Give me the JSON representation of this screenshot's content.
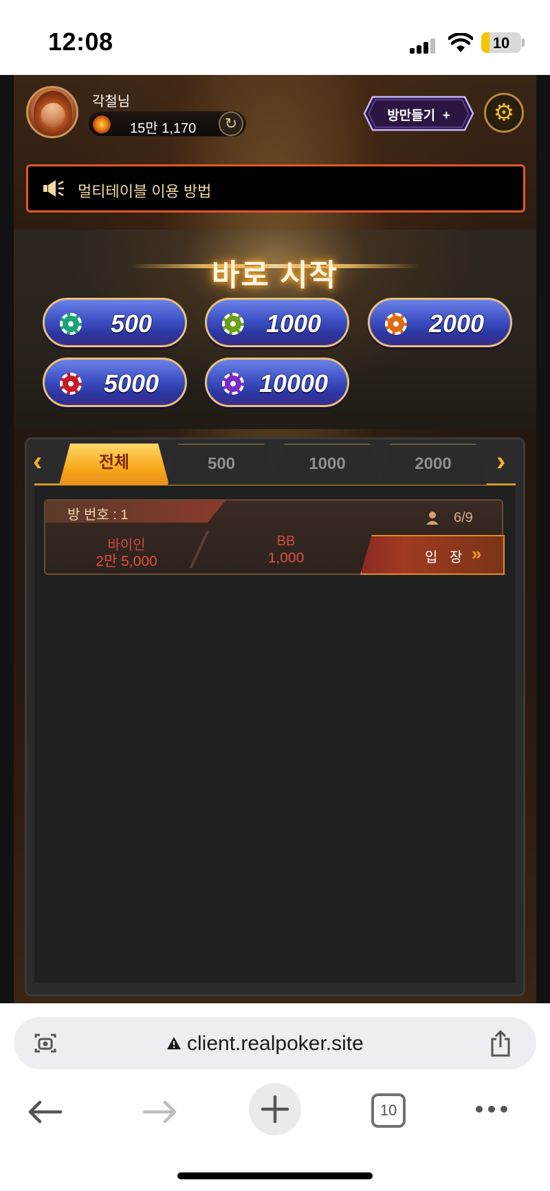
{
  "status_bar": {
    "time": "12:08",
    "battery": "10"
  },
  "header": {
    "user_name": "각철님",
    "money": "15만 1,170",
    "make_room_label": "방만들기",
    "make_room_plus": "+"
  },
  "notice": {
    "text": "멀티테이블 이용 방법"
  },
  "quick_start": {
    "title": "바로 시작",
    "stakes": [
      {
        "value": "500",
        "chip_color": "#1aa37a"
      },
      {
        "value": "1000",
        "chip_color": "#6aa11a"
      },
      {
        "value": "2000",
        "chip_color": "#e06a10"
      },
      {
        "value": "5000",
        "chip_color": "#c41a28"
      },
      {
        "value": "10000",
        "chip_color": "#7a2ac8"
      }
    ]
  },
  "room_tabs": [
    {
      "label": "전체",
      "active": true
    },
    {
      "label": "500",
      "active": false
    },
    {
      "label": "1000",
      "active": false
    },
    {
      "label": "2000",
      "active": false
    }
  ],
  "rooms": [
    {
      "room_no": "방 번호 : 1",
      "players": "6/9",
      "buyin_label": "바이인",
      "buyin_value": "2만 5,000",
      "bb_label": "BB",
      "bb_value": "1,000",
      "enter_label": "입 장"
    }
  ],
  "browser": {
    "url": "client.realpoker.site",
    "tab_count": "10"
  }
}
